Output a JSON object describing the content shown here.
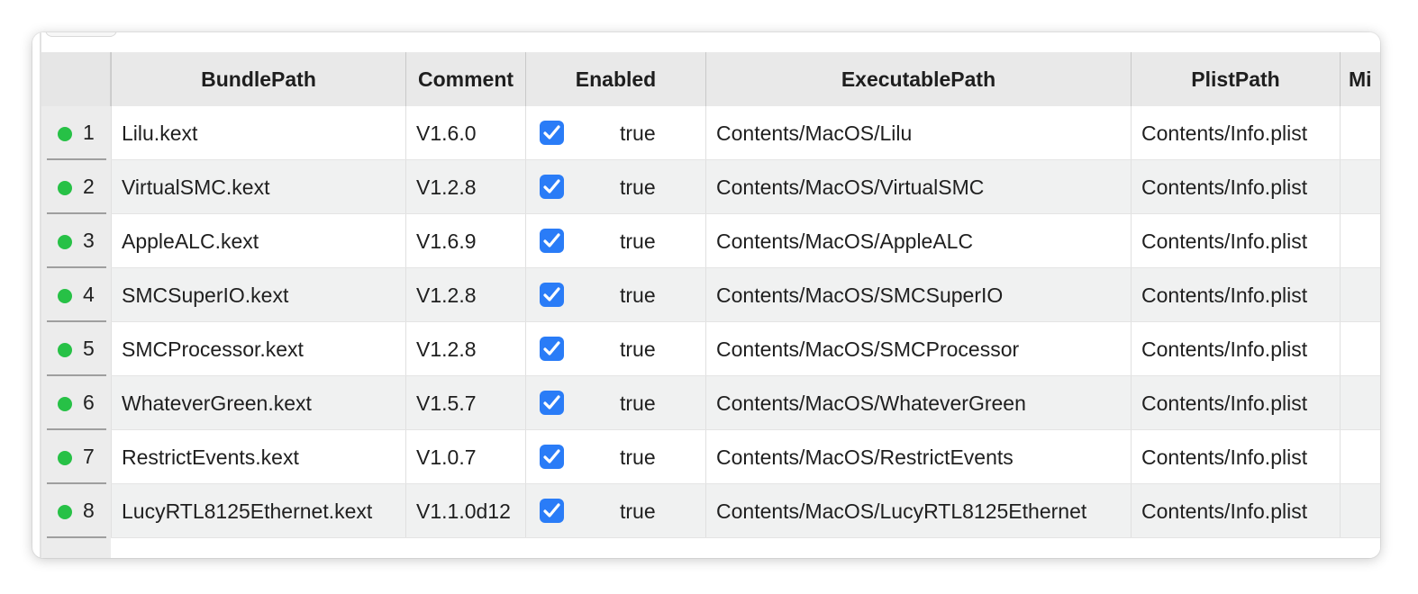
{
  "table": {
    "columns": [
      "BundlePath",
      "Comment",
      "Enabled",
      "ExecutablePath",
      "PlistPath",
      "Mi"
    ],
    "rows": [
      {
        "index": "1",
        "bundle": "Lilu.kext",
        "comment": "V1.6.0",
        "enabled": "true",
        "exec": "Contents/MacOS/Lilu",
        "plist": "Contents/Info.plist"
      },
      {
        "index": "2",
        "bundle": "VirtualSMC.kext",
        "comment": "V1.2.8",
        "enabled": "true",
        "exec": "Contents/MacOS/VirtualSMC",
        "plist": "Contents/Info.plist"
      },
      {
        "index": "3",
        "bundle": "AppleALC.kext",
        "comment": "V1.6.9",
        "enabled": "true",
        "exec": "Contents/MacOS/AppleALC",
        "plist": "Contents/Info.plist"
      },
      {
        "index": "4",
        "bundle": "SMCSuperIO.kext",
        "comment": "V1.2.8",
        "enabled": "true",
        "exec": "Contents/MacOS/SMCSuperIO",
        "plist": "Contents/Info.plist"
      },
      {
        "index": "5",
        "bundle": "SMCProcessor.kext",
        "comment": "V1.2.8",
        "enabled": "true",
        "exec": "Contents/MacOS/SMCProcessor",
        "plist": "Contents/Info.plist"
      },
      {
        "index": "6",
        "bundle": "WhateverGreen.kext",
        "comment": "V1.5.7",
        "enabled": "true",
        "exec": "Contents/MacOS/WhateverGreen",
        "plist": "Contents/Info.plist"
      },
      {
        "index": "7",
        "bundle": "RestrictEvents.kext",
        "comment": "V1.0.7",
        "enabled": "true",
        "exec": "Contents/MacOS/RestrictEvents",
        "plist": "Contents/Info.plist"
      },
      {
        "index": "8",
        "bundle": "LucyRTL8125Ethernet.kext",
        "comment": "V1.1.0d12",
        "enabled": "true",
        "exec": "Contents/MacOS/LucyRTL8125Ethernet",
        "plist": "Contents/Info.plist"
      }
    ]
  },
  "colors": {
    "status_dot": "#27c146",
    "checkbox": "#2a7cf7",
    "header_bg": "#e9e9e9",
    "alt_row_bg": "#f0f1f1"
  },
  "icons": {
    "status": "green-dot-icon",
    "check": "checkmark-icon"
  }
}
